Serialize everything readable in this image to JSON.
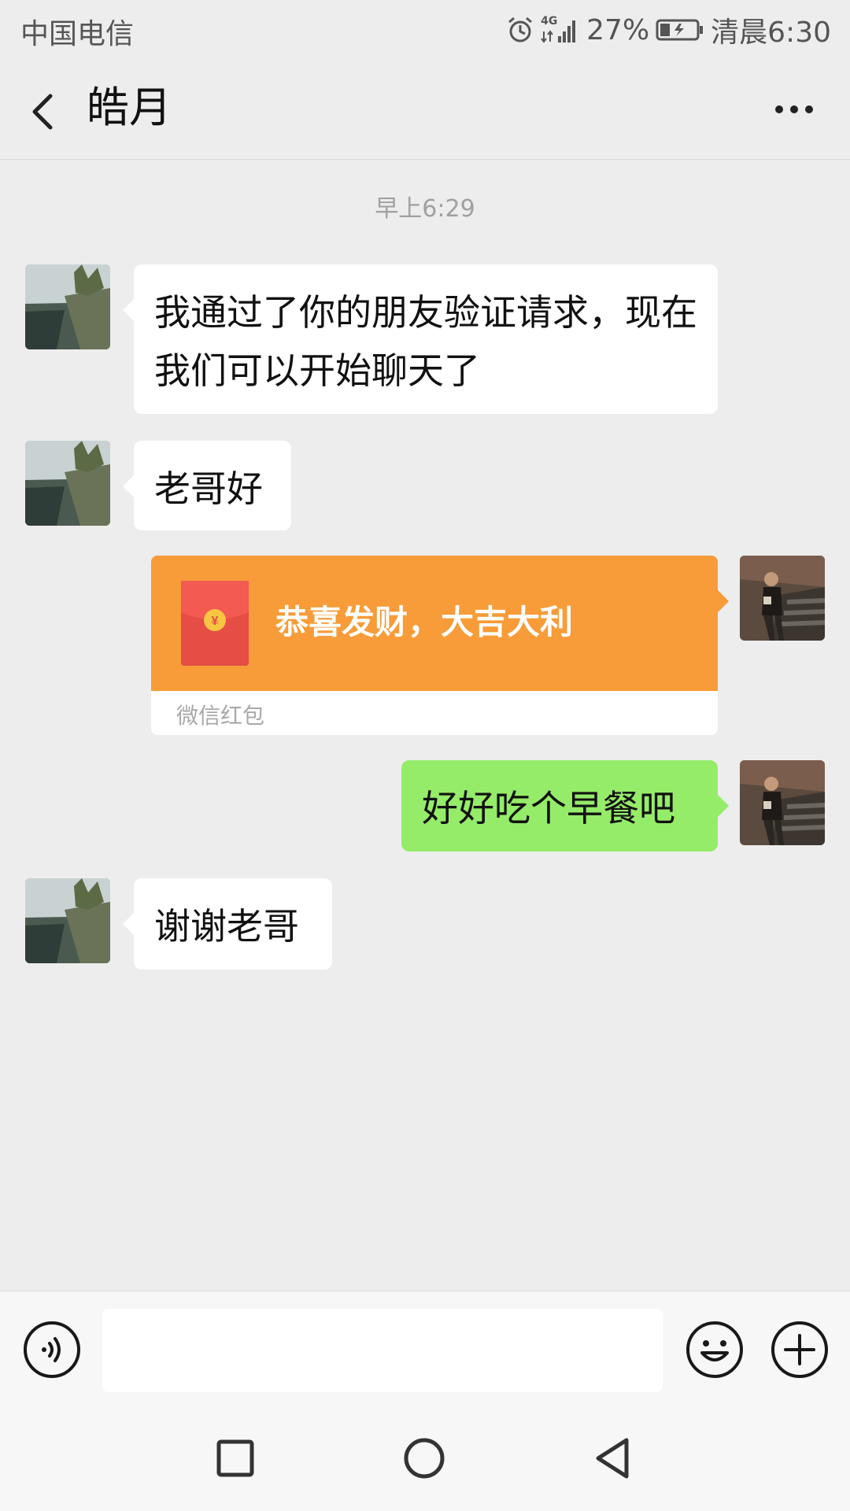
{
  "status_bar": {
    "carrier": "中国电信",
    "network": "4G",
    "battery_percent": "27%",
    "time": "清晨6:30"
  },
  "header": {
    "title": "皓月",
    "back_icon": "chevron-left-icon",
    "more_icon": "more-dots-icon"
  },
  "chat": {
    "timestamp": "早上6:29",
    "messages": [
      {
        "side": "left",
        "type": "text",
        "text": "我通过了你的朋友验证请求，现在我们可以开始聊天了"
      },
      {
        "side": "left",
        "type": "text",
        "text": "老哥好"
      },
      {
        "side": "right",
        "type": "red_packet",
        "text": "恭喜发财，大吉大利",
        "label": "微信红包"
      },
      {
        "side": "right",
        "type": "text",
        "text": "好好吃个早餐吧"
      },
      {
        "side": "left",
        "type": "text",
        "text": "谢谢老哥"
      }
    ],
    "colors": {
      "background": "#ededed",
      "incoming_bubble": "#ffffff",
      "outgoing_bubble": "#95ec69",
      "red_packet": "#f79c38"
    }
  },
  "input_bar": {
    "value": "",
    "placeholder": "",
    "voice_icon": "voice-icon",
    "emoji_icon": "emoji-icon",
    "plus_icon": "plus-icon"
  },
  "nav_bar": {
    "recent_icon": "square-icon",
    "home_icon": "circle-icon",
    "back_icon": "triangle-back-icon"
  }
}
